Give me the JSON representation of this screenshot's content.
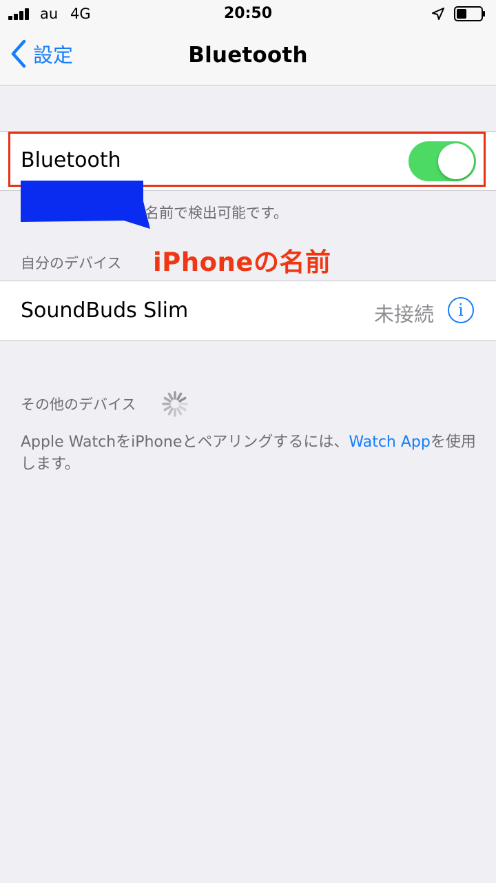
{
  "status_bar": {
    "carrier": "au",
    "network": "4G",
    "time": "20:50",
    "icons": [
      "signal-bars-icon",
      "location-arrow-icon",
      "battery-icon"
    ]
  },
  "nav": {
    "back_label": "設定",
    "title": "Bluetooth"
  },
  "bluetooth": {
    "label": "Bluetooth",
    "enabled": true,
    "footer": "名前で検出可能です。"
  },
  "annotation": {
    "text": "iPhoneの名前",
    "color": "#f03714"
  },
  "my_devices": {
    "header": "自分のデバイス",
    "items": [
      {
        "name": "SoundBuds Slim",
        "status": "未接続",
        "info_label": "i"
      }
    ]
  },
  "other_devices": {
    "header": "その他のデバイス",
    "searching": true
  },
  "help": {
    "text_before": "Apple WatchをiPhoneとペアリングするには、",
    "link": "Watch App",
    "text_after": "を使用します。"
  },
  "colors": {
    "accent": "#147efb",
    "toggle_on": "#4cd964",
    "background": "#efeff4",
    "highlight_border": "#e83015",
    "redaction": "#0a2cf0"
  }
}
